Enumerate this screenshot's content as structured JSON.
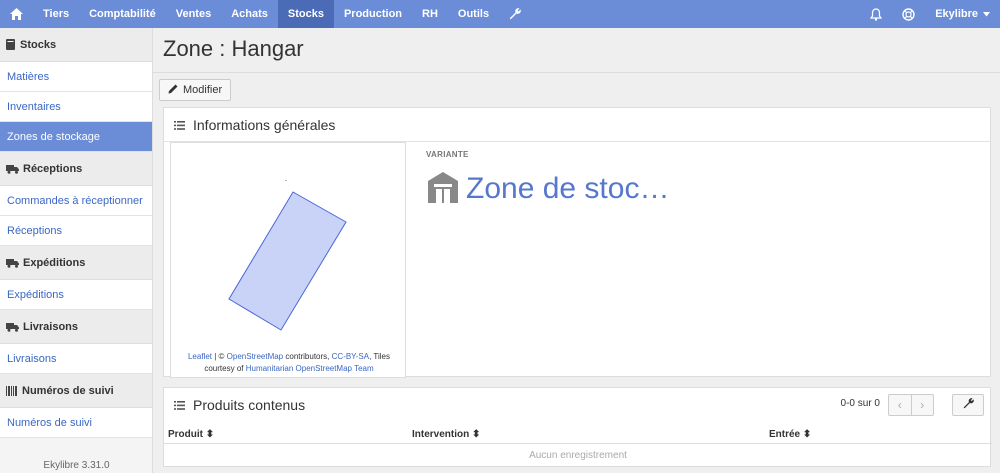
{
  "nav": {
    "items": [
      "Tiers",
      "Comptabilité",
      "Ventes",
      "Achats",
      "Stocks",
      "Production",
      "RH",
      "Outils"
    ],
    "active": "Stocks",
    "user": "Ekylibre"
  },
  "sidebar": {
    "sections": [
      {
        "title": "Stocks",
        "links": [
          "Matières",
          "Inventaires",
          "Zones de stockage"
        ]
      },
      {
        "title": "Réceptions",
        "links": [
          "Commandes à réceptionner",
          "Réceptions"
        ]
      },
      {
        "title": "Expéditions",
        "links": [
          "Expéditions"
        ]
      },
      {
        "title": "Livraisons",
        "links": [
          "Livraisons"
        ]
      },
      {
        "title": "Numéros de suivi",
        "links": [
          "Numéros de suivi"
        ]
      }
    ],
    "active_link": "Zones de stockage",
    "version": "Ekylibre 3.31.0"
  },
  "page": {
    "title": "Zone : Hangar",
    "edit_button": "Modifier"
  },
  "info_panel": {
    "title": "Informations générales",
    "variant_label": "VARIANTE",
    "variant_value": "Zone de stoc…",
    "attribution": {
      "leaflet": "Leaflet",
      "sep": " | © ",
      "osm": "OpenStreetMap",
      "contributors": " contributors, ",
      "license": "CC-BY-SA",
      "tiles": ", Tiles",
      "courtesy": "courtesy of ",
      "team": "Humanitarian OpenStreetMap Team"
    }
  },
  "products_panel": {
    "title": "Produits contenus",
    "pager_text": "0-0 sur 0",
    "columns": [
      "Produit",
      "Intervention",
      "Entrée"
    ],
    "empty": "Aucun enregistrement"
  }
}
